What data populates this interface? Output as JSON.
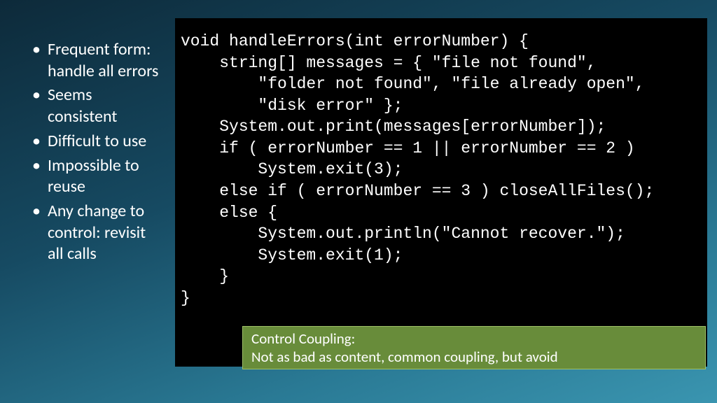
{
  "bullets": {
    "items": [
      "Frequent form: handle all errors",
      "Seems consistent",
      "Difficult to use",
      "Impossible to reuse",
      "Any change to control: revisit all calls"
    ]
  },
  "code": "void handleErrors(int errorNumber) {\n    string[] messages = { \"file not found\",\n        \"folder not found\", \"file already open\",\n        \"disk error\" };\n    System.out.print(messages[errorNumber]);\n    if ( errorNumber == 1 || errorNumber == 2 )\n        System.exit(3);\n    else if ( errorNumber == 3 ) closeAllFiles();\n    else {\n        System.out.println(\"Cannot recover.\");\n        System.exit(1);\n    }\n}",
  "callout": {
    "line1": "Control Coupling:",
    "line2": "Not as bad as content, common coupling, but avoid"
  }
}
